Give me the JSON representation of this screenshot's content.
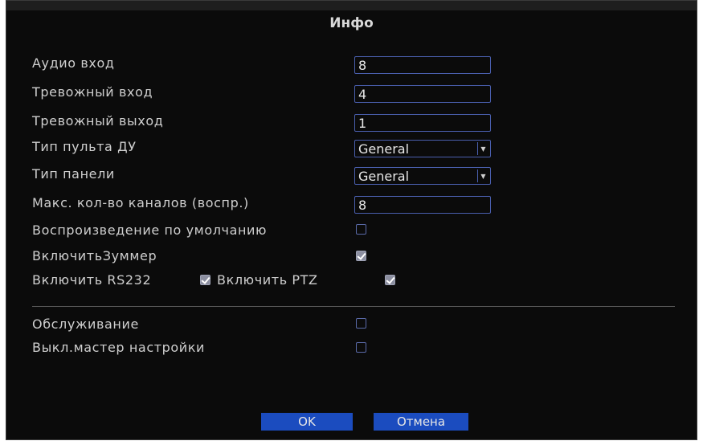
{
  "dialog": {
    "title": "Инфо"
  },
  "fields": {
    "audio_in": {
      "label": "Аудио вход",
      "value": "8"
    },
    "alarm_in": {
      "label": "Тревожный вход",
      "value": "4"
    },
    "alarm_out": {
      "label": "Тревожный выход",
      "value": "1"
    },
    "remote_type": {
      "label": "Тип пульта ДУ",
      "value": "General"
    },
    "panel_type": {
      "label": "Тип панели",
      "value": "General"
    },
    "max_playback": {
      "label": "Макс. кол-во каналов (воспр.)",
      "value": "8"
    },
    "default_playback": {
      "label": "Воспроизведение по умолчанию",
      "checked": false
    },
    "buzzer": {
      "label": "ВключитьЗуммер",
      "checked": true
    },
    "rs232": {
      "label": "Включить RS232",
      "checked": true
    },
    "ptz": {
      "label": "Включить PTZ",
      "checked": true
    },
    "maintenance": {
      "label": "Обслуживание",
      "checked": false
    },
    "wizard_off": {
      "label": "Выкл.мастер настройки",
      "checked": false
    }
  },
  "buttons": {
    "ok": "OK",
    "cancel": "Отмена"
  },
  "colors": {
    "background": "#0b0b0b",
    "field_border": "#4a5fae",
    "button": "#1b4cbf",
    "text": "#cfcfcf"
  }
}
